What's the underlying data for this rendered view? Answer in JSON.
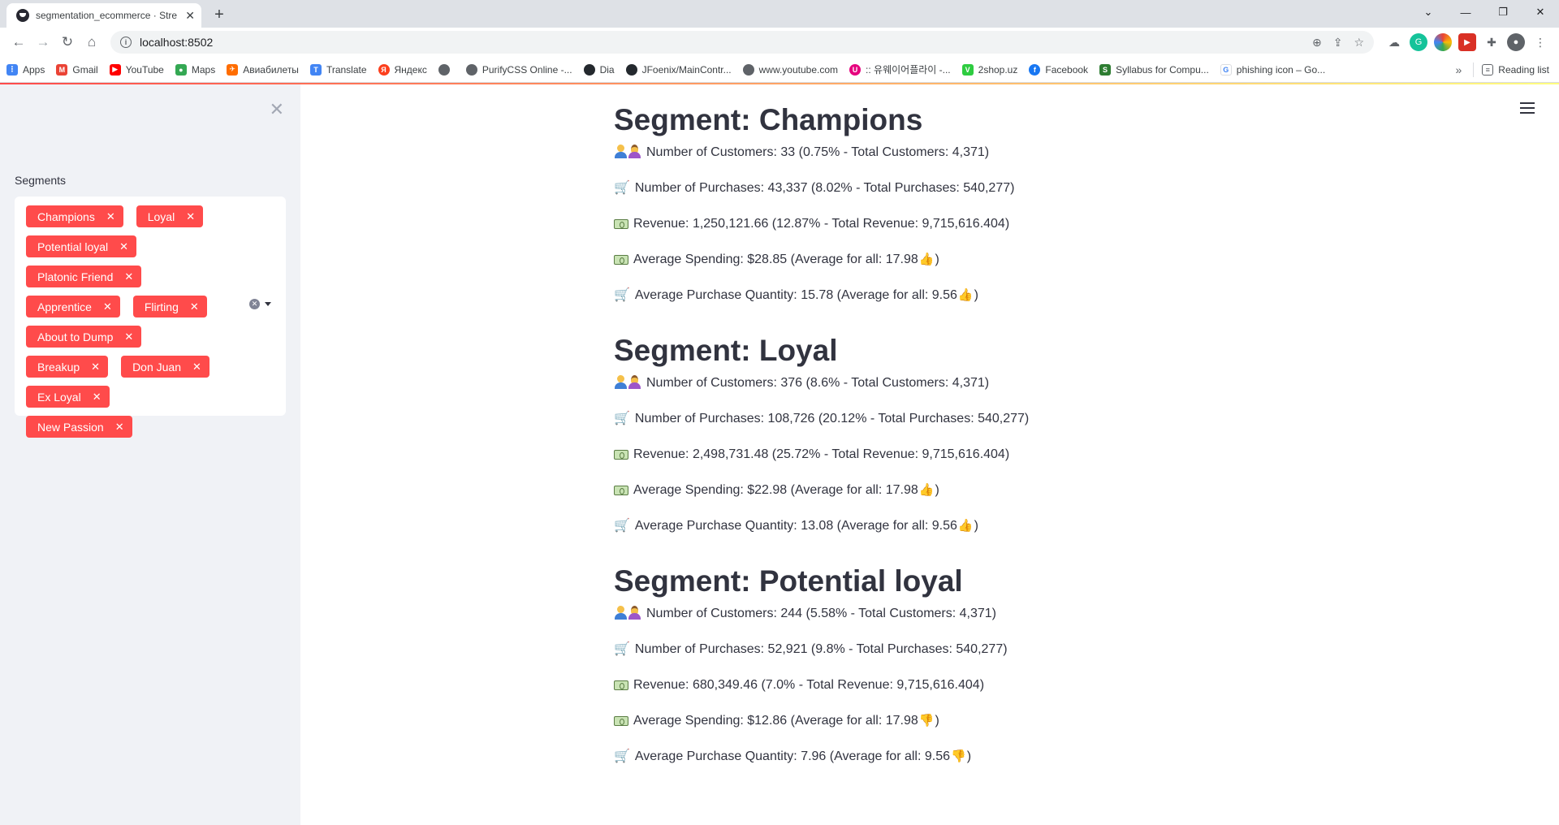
{
  "browser": {
    "tab_title": "segmentation_ecommerce · Stre",
    "url": "localhost:8502",
    "bookmarks": [
      "Apps",
      "Gmail",
      "YouTube",
      "Maps",
      "Авиабилеты",
      "Translate",
      "Яндекс",
      "",
      "PurifyCSS Online -...",
      "Dia",
      "JFoenix/MainContr...",
      "www.youtube.com",
      ":: 유웨이어플라이 -...",
      "2shop.uz",
      "Facebook",
      "Syllabus for Compu...",
      "phishing icon – Go..."
    ],
    "reading_list": "Reading list",
    "colors": {
      "accent": "#ff4b4b",
      "sidebar_bg": "#f0f2f6",
      "chip": "#ff4b4b",
      "text": "#31333f"
    }
  },
  "sidebar": {
    "label": "Segments",
    "chips": [
      "Champions",
      "Loyal",
      "Potential loyal",
      "Platonic Friend",
      "Apprentice",
      "Flirting",
      "About to Dump",
      "Breakup",
      "Don Juan",
      "Ex Loyal",
      "New Passion"
    ]
  },
  "segments": [
    {
      "title": "Segment: Champions",
      "customers": "Number of Customers: 33 (0.75% - Total Customers: 4,371)",
      "purchases": "Number of Purchases: 43,337 (8.02% - Total Purchases: 540,277)",
      "revenue": "Revenue: 1,250,121.66 (12.87% - Total Revenue: 9,715,616.404)",
      "spending": "Average Spending: $28.85 (Average for all: 17.98",
      "spending_icon": "thumbs-up",
      "quantity": "Average Purchase Quantity: 15.78 (Average for all: 9.56",
      "quantity_icon": "thumbs-up"
    },
    {
      "title": "Segment: Loyal",
      "customers": "Number of Customers: 376 (8.6% - Total Customers: 4,371)",
      "purchases": "Number of Purchases: 108,726 (20.12% - Total Purchases: 540,277)",
      "revenue": "Revenue: 2,498,731.48 (25.72% - Total Revenue: 9,715,616.404)",
      "spending": "Average Spending: $22.98 (Average for all: 17.98",
      "spending_icon": "thumbs-up",
      "quantity": "Average Purchase Quantity: 13.08 (Average for all: 9.56",
      "quantity_icon": "thumbs-up"
    },
    {
      "title": "Segment: Potential loyal",
      "customers": "Number of Customers: 244 (5.58% - Total Customers: 4,371)",
      "purchases": "Number of Purchases: 52,921 (9.8% - Total Purchases: 540,277)",
      "revenue": "Revenue: 680,349.46 (7.0% - Total Revenue: 9,715,616.404)",
      "spending": "Average Spending: $12.86 (Average for all: 17.98",
      "spending_icon": "thumbs-down",
      "quantity": "Average Purchase Quantity: 7.96 (Average for all: 9.56",
      "quantity_icon": "thumbs-down"
    }
  ],
  "close_paren": ")"
}
